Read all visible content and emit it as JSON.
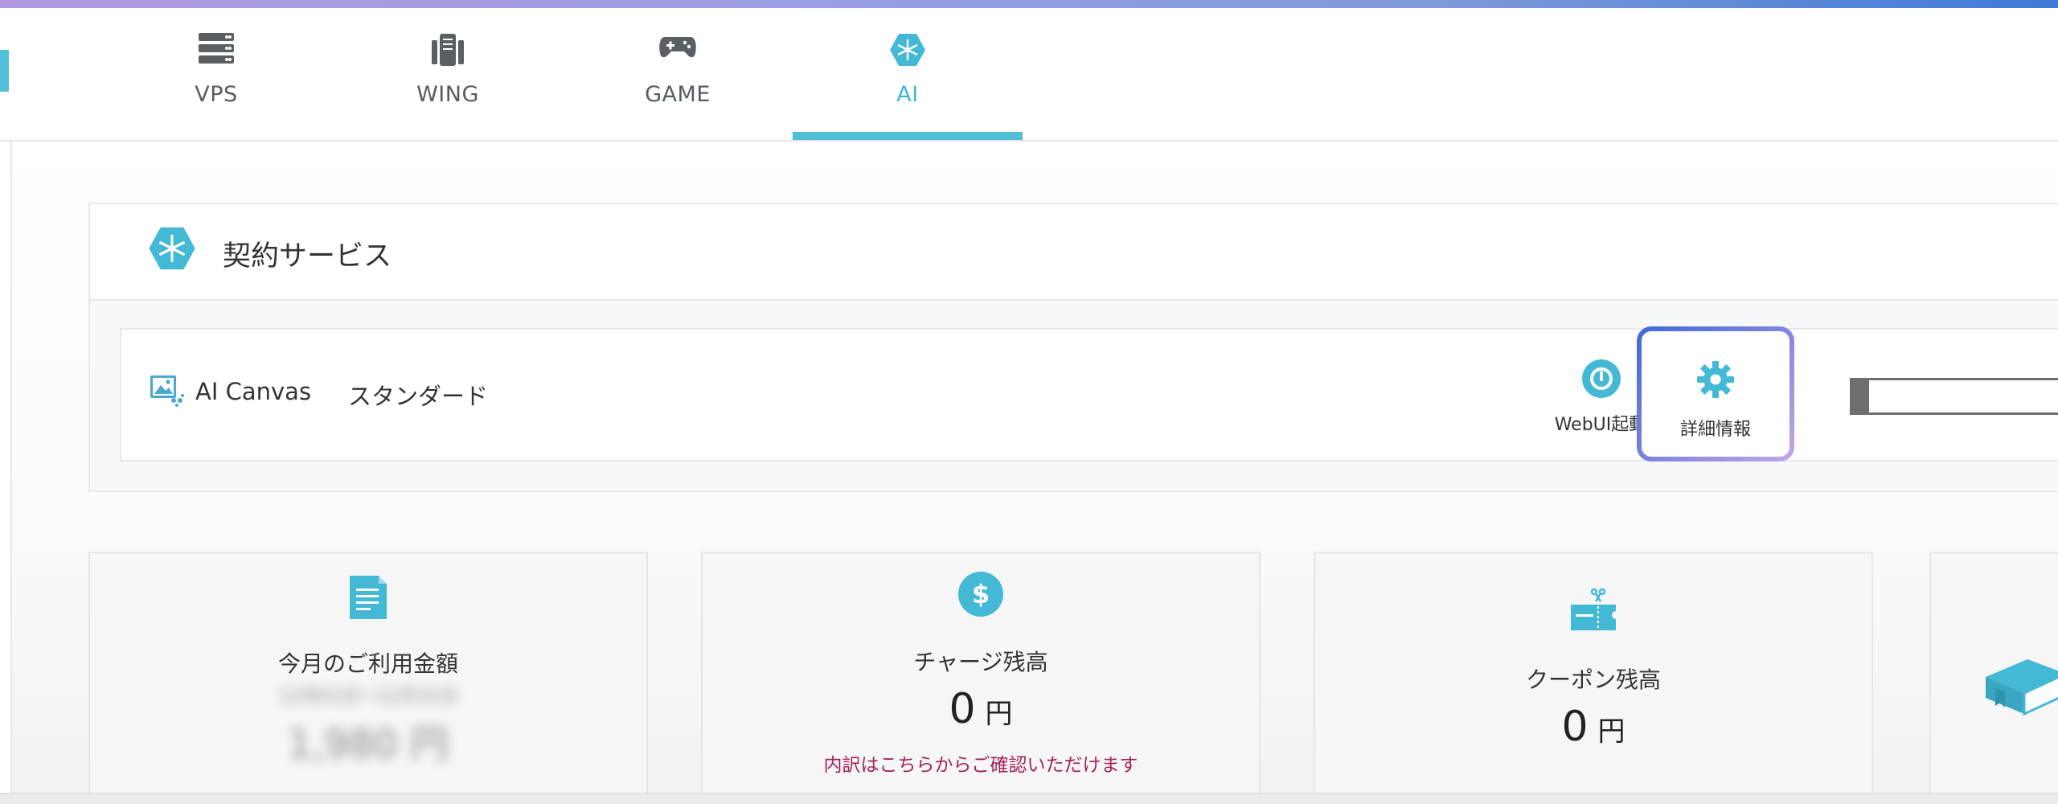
{
  "nav": {
    "tabs": [
      {
        "label": "VPS",
        "icon": "server-icon",
        "active": false
      },
      {
        "label": "WING",
        "icon": "server-rack-icon",
        "active": false
      },
      {
        "label": "GAME",
        "icon": "gamepad-icon",
        "active": false
      },
      {
        "label": "AI",
        "icon": "ai-brain-icon",
        "active": true
      }
    ]
  },
  "section": {
    "title": "契約サービス",
    "icon": "ai-brain-icon"
  },
  "service": {
    "name": "AI Canvas",
    "plan": "スタンダード",
    "icon": "image-gallery-icon",
    "webui_label": "WebUI起動",
    "detail_label": "詳細情報"
  },
  "progress": {
    "value_fraction": 0.07
  },
  "stats": {
    "monthly": {
      "label": "今月のご利用金額",
      "blurred_line1": "12月01日〜12月31日",
      "blurred_amount": "1,980 円",
      "icon": "invoice-icon"
    },
    "charge": {
      "label": "チャージ残高",
      "amount": "0",
      "unit": "円",
      "link": "内訳はこちらからご確認いただけます",
      "icon": "dollar-circle-icon"
    },
    "coupon": {
      "label": "クーポン残高",
      "amount": "0",
      "unit": "円",
      "icon": "coupon-ticket-icon"
    }
  },
  "colors": {
    "accent": "#4ebfd7",
    "link": "#a4235a",
    "highlight_border_start": "#3f6ad8",
    "highlight_border_end": "#c4a6e6"
  }
}
